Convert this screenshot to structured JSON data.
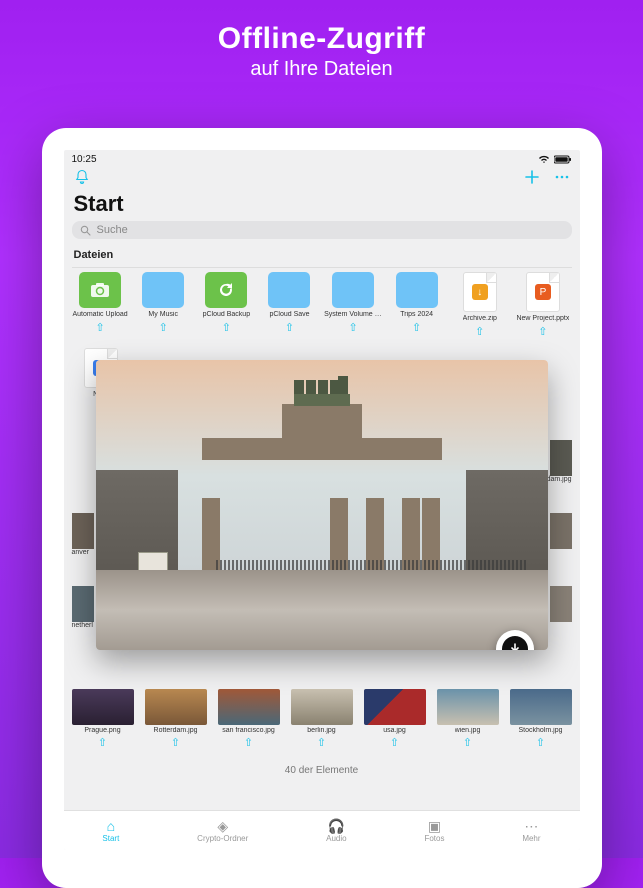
{
  "promo": {
    "title": "Offline-Zugriff",
    "subtitle": "auf Ihre Dateien"
  },
  "statusbar": {
    "time": "10:25"
  },
  "header": {
    "title": "Start"
  },
  "search": {
    "placeholder": "Suche"
  },
  "section": {
    "files_label": "Dateien"
  },
  "tiles": [
    {
      "name": "Automatic Upload"
    },
    {
      "name": "My Music"
    },
    {
      "name": "pCloud Backup"
    },
    {
      "name": "pCloud Save"
    },
    {
      "name": "System Volume Inf..."
    },
    {
      "name": "Trips 2024"
    },
    {
      "name": "Archive.zip"
    },
    {
      "name": "New Project.pptx"
    }
  ],
  "docfile": {
    "name": "Note"
  },
  "peek_thumbs": {
    "r1_right": "dam.jpg",
    "r2_left": "anver",
    "r3_left": "netherl"
  },
  "thumbs": [
    {
      "name": "Prague.png"
    },
    {
      "name": "Rotterdam.jpg"
    },
    {
      "name": "san francisco.jpg"
    },
    {
      "name": "berlin.jpg"
    },
    {
      "name": "usa.jpg"
    },
    {
      "name": "wien.jpg"
    },
    {
      "name": "Stockholm.jpg"
    }
  ],
  "footer": {
    "count": "40 der Elemente"
  },
  "tabs": {
    "start": "Start",
    "crypto": "Crypto-Ordner",
    "audio": "Audio",
    "fotos": "Fotos",
    "mehr": "Mehr"
  }
}
